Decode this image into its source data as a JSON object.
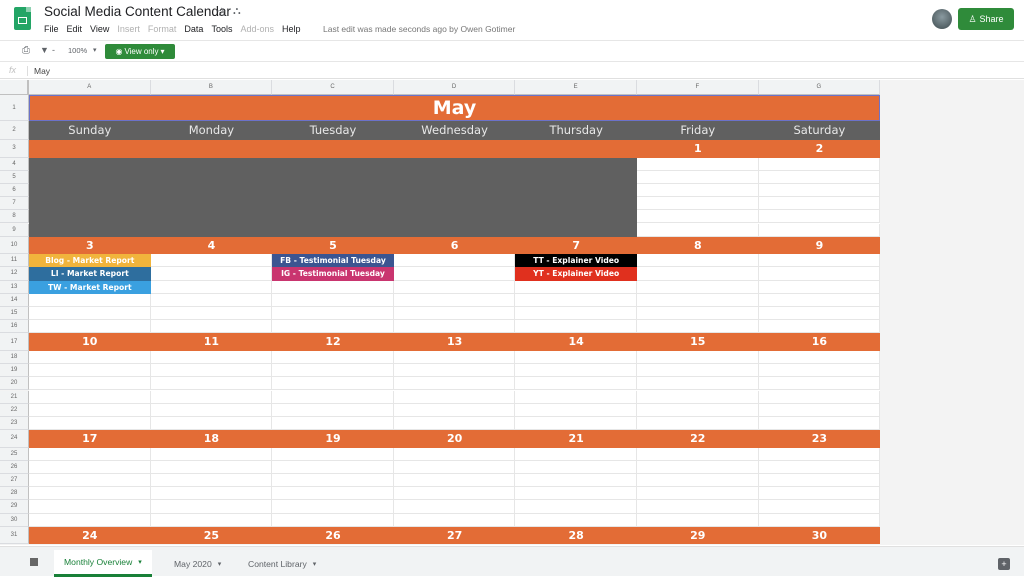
{
  "app": {
    "title": "Social Media Content Calendar",
    "star_icon": "star-icon",
    "drive_icon": "drive-status-icon",
    "menu": [
      {
        "label": "File",
        "enabled": true
      },
      {
        "label": "Edit",
        "enabled": true
      },
      {
        "label": "View",
        "enabled": true
      },
      {
        "label": "Insert",
        "enabled": false
      },
      {
        "label": "Format",
        "enabled": false
      },
      {
        "label": "Data",
        "enabled": true
      },
      {
        "label": "Tools",
        "enabled": true
      },
      {
        "label": "Add-ons",
        "enabled": false
      },
      {
        "label": "Help",
        "enabled": true
      }
    ],
    "last_edit": "Last edit was made seconds ago by Owen Gotimer",
    "share_label": "Share"
  },
  "toolbar": {
    "zoom": "100%",
    "view_only_label": "View only"
  },
  "formula_bar": {
    "fx": "fx",
    "value": "May"
  },
  "columns": [
    "A",
    "B",
    "C",
    "D",
    "E",
    "F",
    "G"
  ],
  "rows": [
    "1",
    "2",
    "3",
    "4",
    "5",
    "6",
    "7",
    "8",
    "9",
    "10",
    "11",
    "12",
    "13",
    "14",
    "15",
    "16",
    "17",
    "18",
    "19",
    "20",
    "21",
    "22",
    "23",
    "24",
    "25",
    "26",
    "27",
    "28",
    "29",
    "30",
    "31"
  ],
  "calendar": {
    "month": "May",
    "weekdays": [
      "Sunday",
      "Monday",
      "Tuesday",
      "Wednesday",
      "Thursday",
      "Friday",
      "Saturday"
    ],
    "weeks": [
      [
        "",
        "",
        "",
        "",
        "",
        "1",
        "2"
      ],
      [
        "3",
        "4",
        "5",
        "6",
        "7",
        "8",
        "9"
      ],
      [
        "10",
        "11",
        "12",
        "13",
        "14",
        "15",
        "16"
      ],
      [
        "17",
        "18",
        "19",
        "20",
        "21",
        "22",
        "23"
      ],
      [
        "24",
        "25",
        "26",
        "27",
        "28",
        "29",
        "30"
      ]
    ],
    "events": [
      {
        "label": "Blog - Market Report",
        "day": "3",
        "color": "#f1b43c"
      },
      {
        "label": "LI - Market Report",
        "day": "3",
        "color": "#2e6e9e"
      },
      {
        "label": "TW - Market Report",
        "day": "3",
        "color": "#3aa0e0"
      },
      {
        "label": "FB - Testimonial Tuesday",
        "day": "5",
        "color": "#3b5591"
      },
      {
        "label": "IG - Testimonial Tuesday",
        "day": "5",
        "color": "#c9356f"
      },
      {
        "label": "TT - Explainer Video",
        "day": "7",
        "color": "#000000"
      },
      {
        "label": "YT - Explainer Video",
        "day": "7",
        "color": "#e0301e"
      }
    ],
    "colors": {
      "accent": "#e36c36",
      "header_gray": "#606060"
    }
  },
  "sheet_tabs": [
    {
      "label": "Monthly Overview",
      "active": true
    },
    {
      "label": "May 2020",
      "active": false
    },
    {
      "label": "Content Library",
      "active": false
    }
  ]
}
